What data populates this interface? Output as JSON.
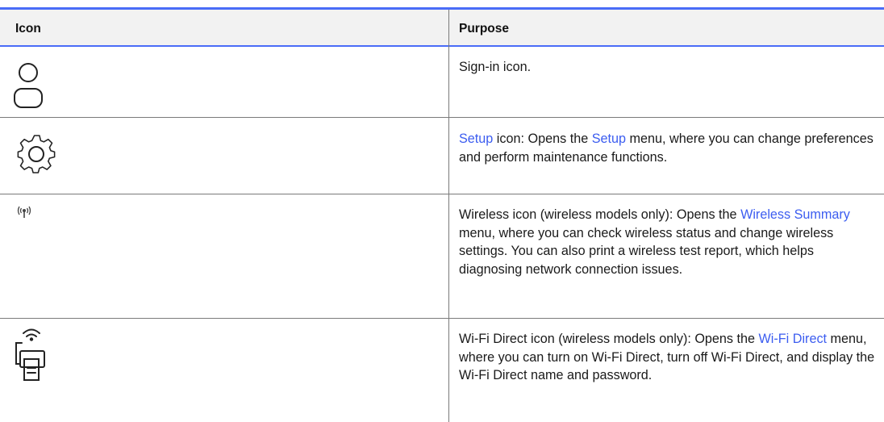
{
  "table": {
    "headers": {
      "icon": "Icon",
      "purpose": "Purpose"
    },
    "rows": [
      {
        "icon": "sign-in-icon",
        "purpose": {
          "pre": "Sign-in icon."
        }
      },
      {
        "icon": "gear-icon",
        "purpose": {
          "link1": "Setup",
          "mid1": " icon: Opens the ",
          "link2": "Setup",
          "post": " menu, where you can change preferences and perform maintenance functions."
        }
      },
      {
        "icon": "wireless-icon",
        "purpose": {
          "pre": "Wireless icon (wireless models only): Opens the ",
          "link": "Wireless Summary",
          "post": " menu, where you can check wireless status and change wireless settings. You can also print a wireless test report, which helps diagnosing network connection issues."
        }
      },
      {
        "icon": "wifi-direct-icon",
        "purpose": {
          "pre": "Wi-Fi Direct icon (wireless models only): Opens the ",
          "link": "Wi-Fi Direct",
          "post": " menu, where you can turn on Wi-Fi Direct, turn off Wi-Fi Direct, and display the Wi-Fi Direct name and password."
        }
      }
    ]
  },
  "colors": {
    "accent": "#4a6cf7",
    "link": "#3c5df0",
    "header_bg": "#f2f2f2",
    "rule": "#7a7a7a"
  }
}
